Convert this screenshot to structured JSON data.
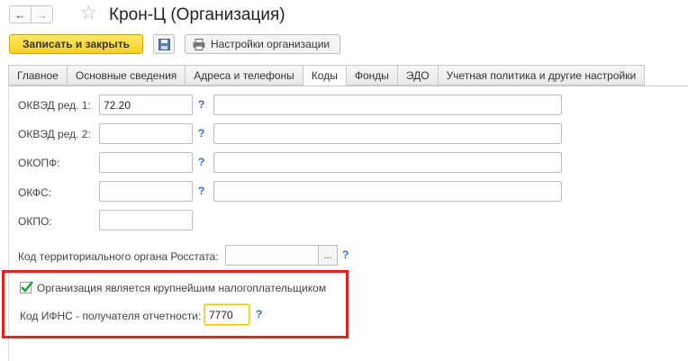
{
  "window": {
    "title": "Крон-Ц (Организация)",
    "back_icon": "arrow-left-icon",
    "forward_icon": "arrow-right-icon",
    "favorite_icon": "star-icon"
  },
  "toolbar": {
    "save_close_label": "Записать и закрыть",
    "save_icon": "floppy-icon",
    "settings_icon": "printer-icon",
    "settings_label": "Настройки организации"
  },
  "tabs": [
    {
      "label": "Главное",
      "active": false
    },
    {
      "label": "Основные сведения",
      "active": false
    },
    {
      "label": "Адреса и телефоны",
      "active": false
    },
    {
      "label": "Коды",
      "active": true
    },
    {
      "label": "Фонды",
      "active": false
    },
    {
      "label": "ЭДО",
      "active": false
    },
    {
      "label": "Учетная политика и другие настройки",
      "active": false
    }
  ],
  "form": {
    "okved1": {
      "label": "ОКВЭД ред. 1:",
      "value": "72.20",
      "help": "?",
      "description": ""
    },
    "okved2": {
      "label": "ОКВЭД ред. 2:",
      "value": "",
      "help": "?",
      "description": ""
    },
    "okopf": {
      "label": "ОКОПФ:",
      "value": "",
      "help": "?",
      "description": ""
    },
    "okfs": {
      "label": "ОКФС:",
      "value": "",
      "help": "?",
      "description": ""
    },
    "okpo": {
      "label": "ОКПО:",
      "value": ""
    },
    "rosstat": {
      "label": "Код территориального органа Росстата:",
      "value": "",
      "select": "...",
      "help": "?"
    },
    "largest_taxpayer": {
      "label": "Организация является крупнейшим налогоплательщиком",
      "checked": true
    },
    "ifns": {
      "label": "Код ИФНС - получателя отчетности:",
      "value": "7770",
      "help": "?"
    }
  },
  "colors": {
    "accent_yellow": "#f7d21c",
    "highlight_red": "#e3241b",
    "help_blue": "#2a6fc9",
    "check_green": "#1a9a3a"
  }
}
